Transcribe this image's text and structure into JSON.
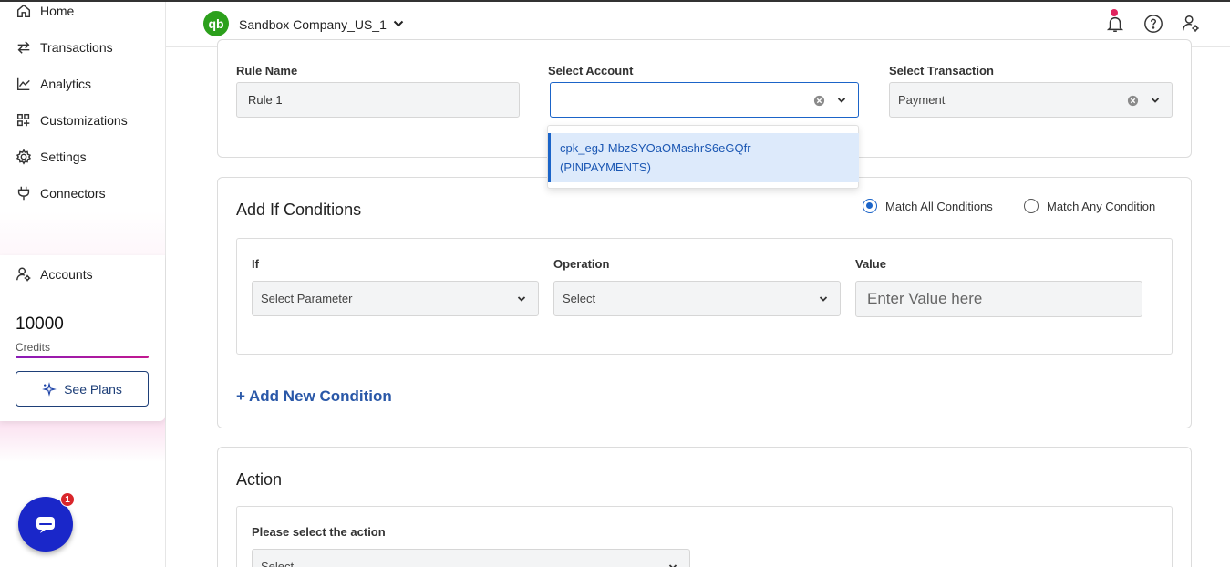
{
  "sidebar": {
    "nav": [
      {
        "label": "Home",
        "icon": "home-icon"
      },
      {
        "label": "Transactions",
        "icon": "transactions-icon"
      },
      {
        "label": "Analytics",
        "icon": "analytics-icon"
      },
      {
        "label": "Customizations",
        "icon": "customizations-icon"
      },
      {
        "label": "Settings",
        "icon": "gear-icon"
      },
      {
        "label": "Connectors",
        "icon": "plug-icon"
      }
    ],
    "accounts_label": "Accounts",
    "credits_value": "10000",
    "credits_label": "Credits",
    "see_plans_label": "See Plans",
    "chat_badge": "1"
  },
  "header": {
    "logo_text": "qb",
    "company_name": "Sandbox Company_US_1"
  },
  "rule": {
    "rule_name_label": "Rule Name",
    "rule_name_value": "Rule 1",
    "select_account_label": "Select Account",
    "select_account_value": "",
    "account_options": [
      "cpk_egJ-MbzSYOaOMashrS6eGQfr",
      "(PINPAYMENTS)"
    ],
    "select_transaction_label": "Select Transaction",
    "select_transaction_value": "Payment"
  },
  "conditions": {
    "title": "Add If Conditions",
    "match_all_label": "Match All Conditions",
    "match_any_label": "Match Any Condition",
    "if_label": "If",
    "if_placeholder": "Select Parameter",
    "operation_label": "Operation",
    "operation_placeholder": "Select",
    "value_label": "Value",
    "value_placeholder": "Enter Value here",
    "add_condition_label": "+ Add New Condition"
  },
  "action": {
    "title": "Action",
    "prompt_label": "Please select the action",
    "select_placeholder": "Select"
  },
  "colors": {
    "accent": "#1b64c8",
    "qb_green": "#2ca01c",
    "link_blue": "#2a58a8",
    "chat_blue": "#1a27c9"
  }
}
